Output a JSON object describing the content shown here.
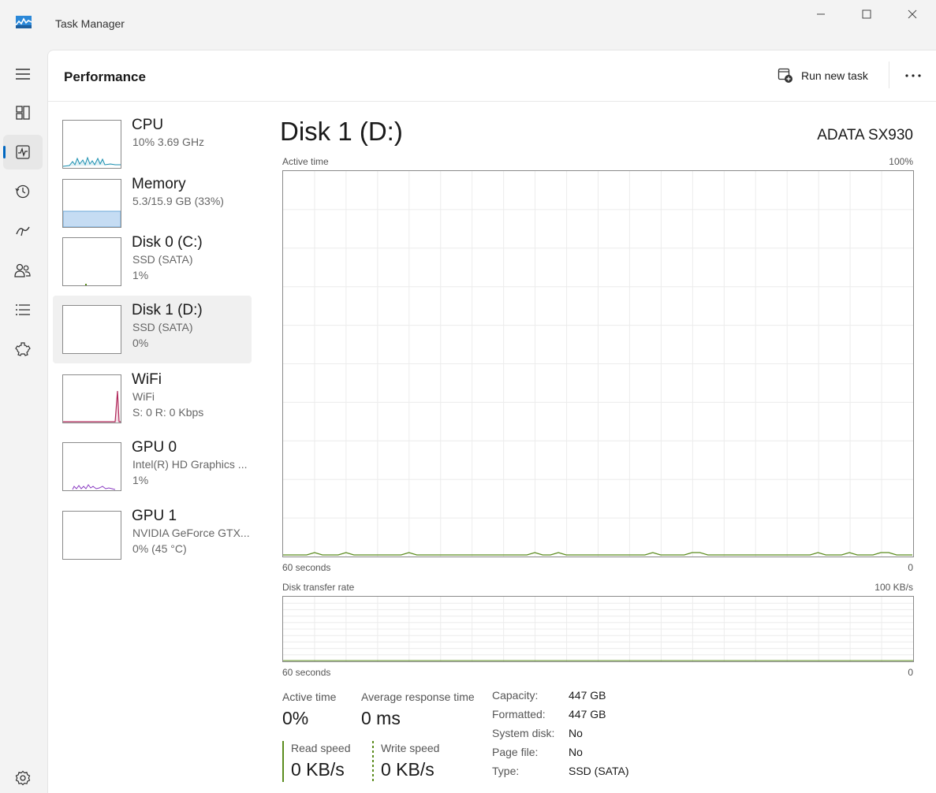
{
  "window": {
    "title": "Task Manager"
  },
  "nav": {
    "items": [
      {
        "name": "hamburger-menu-icon"
      },
      {
        "name": "processes-icon"
      },
      {
        "name": "performance-icon",
        "active": true
      },
      {
        "name": "app-history-icon"
      },
      {
        "name": "startup-apps-icon"
      },
      {
        "name": "users-icon"
      },
      {
        "name": "details-icon"
      },
      {
        "name": "services-icon"
      },
      {
        "name": "settings-icon"
      }
    ]
  },
  "header": {
    "title": "Performance",
    "run_task_label": "Run new task",
    "more_label": "..."
  },
  "devices": [
    {
      "name": "CPU",
      "line1": "10%  3.69 GHz",
      "line2": "",
      "color": "#1a8fb0"
    },
    {
      "name": "Memory",
      "line1": "5.3/15.9 GB (33%)",
      "line2": "",
      "color": "#6aa9d8"
    },
    {
      "name": "Disk 0 (C:)",
      "line1": "SSD (SATA)",
      "line2": "1%",
      "color": "#5b8c1e"
    },
    {
      "name": "Disk 1 (D:)",
      "line1": "SSD (SATA)",
      "line2": "0%",
      "color": "#5b8c1e"
    },
    {
      "name": "WiFi",
      "line1": "WiFi",
      "line2": "S: 0  R: 0 Kbps",
      "color": "#b0285a"
    },
    {
      "name": "GPU 0",
      "line1": "Intel(R) HD Graphics ...",
      "line2": "1%",
      "color": "#8a3bc2"
    },
    {
      "name": "GPU 1",
      "line1": "NVIDIA GeForce GTX...",
      "line2": "0%  (45 °C)",
      "color": "#8a3bc2"
    }
  ],
  "detail": {
    "title": "Disk 1 (D:)",
    "model": "ADATA SX930",
    "active_graph": {
      "label": "Active time",
      "max_label": "100%",
      "time_label": "60 seconds",
      "min_label": "0"
    },
    "transfer_graph": {
      "label": "Disk transfer rate",
      "max_label": "100 KB/s",
      "time_label": "60 seconds",
      "min_label": "0"
    },
    "stats": {
      "active_time_label": "Active time",
      "active_time_value": "0%",
      "avg_response_label": "Average response time",
      "avg_response_value": "0 ms",
      "read_speed_label": "Read speed",
      "read_speed_value": "0 KB/s",
      "write_speed_label": "Write speed",
      "write_speed_value": "0 KB/s"
    },
    "info": [
      {
        "label": "Capacity:",
        "value": "447 GB"
      },
      {
        "label": "Formatted:",
        "value": "447 GB"
      },
      {
        "label": "System disk:",
        "value": "No"
      },
      {
        "label": "Page file:",
        "value": "No"
      },
      {
        "label": "Type:",
        "value": "SSD (SATA)"
      }
    ],
    "accent_color": "#5b8c1e"
  }
}
